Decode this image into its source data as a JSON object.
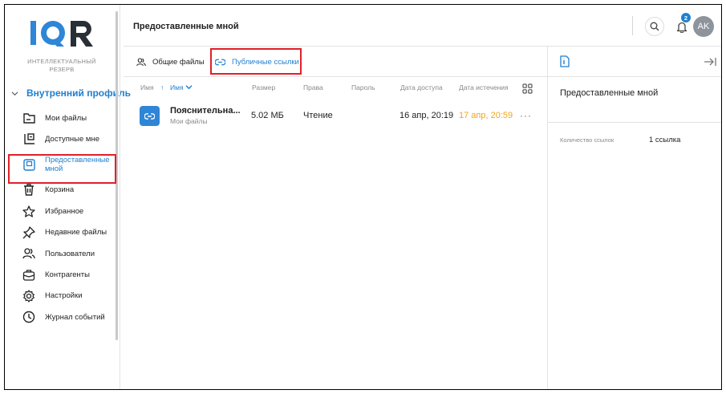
{
  "sidebar": {
    "logo_text": "IQR",
    "logo_subtitle_line1": "ИНТЕЛЛЕКТУАЛЬНЫЙ",
    "logo_subtitle_line2": "РЕЗЕРВ",
    "profile_label": "Внутренний профиль",
    "items": [
      {
        "label": "Мои файлы",
        "icon": "folder-icon"
      },
      {
        "label": "Доступные мне",
        "icon": "shared-with-me-icon"
      },
      {
        "label": "Предоставленные мной",
        "icon": "shared-by-me-icon",
        "active": true
      },
      {
        "label": "Корзина",
        "icon": "trash-icon"
      },
      {
        "label": "Избранное",
        "icon": "star-icon"
      },
      {
        "label": "Недавние файлы",
        "icon": "pin-icon"
      },
      {
        "label": "Пользователи",
        "icon": "users-icon"
      },
      {
        "label": "Контрагенты",
        "icon": "contractors-icon"
      },
      {
        "label": "Настройки",
        "icon": "gear-icon"
      },
      {
        "label": "Журнал событий",
        "icon": "clock-icon"
      }
    ]
  },
  "header": {
    "title": "Предоставленные мной",
    "notifications_count": "2",
    "avatar_initials": "AK"
  },
  "tabs": [
    {
      "label": "Общие файлы",
      "icon": "users-icon",
      "active": false
    },
    {
      "label": "Публичные ссылки",
      "icon": "link-icon",
      "active": true
    }
  ],
  "table": {
    "columns": {
      "name": "Имя",
      "sort_arrow": "↑",
      "sort_by": "Имя",
      "size": "Размер",
      "rights": "Права",
      "password": "Пароль",
      "access_date": "Дата доступа",
      "expiry_date": "Дата истечения"
    },
    "rows": [
      {
        "name": "Пояснительна...",
        "location": "Мои файлы",
        "size": "5.02 МБ",
        "rights": "Чтение",
        "password": "",
        "access_date": "16 апр, 20:19",
        "expiry_date": "17 апр, 20:59",
        "more": "···"
      }
    ]
  },
  "details_panel": {
    "title": "Предоставленные мной",
    "links_count_label": "Количество ссылок",
    "links_count_value": "1 ссылка"
  },
  "colors": {
    "accent": "#1f7fcf",
    "expiry": "#f2a51a",
    "highlight": "#e0202a",
    "avatar": "#8e949c"
  }
}
